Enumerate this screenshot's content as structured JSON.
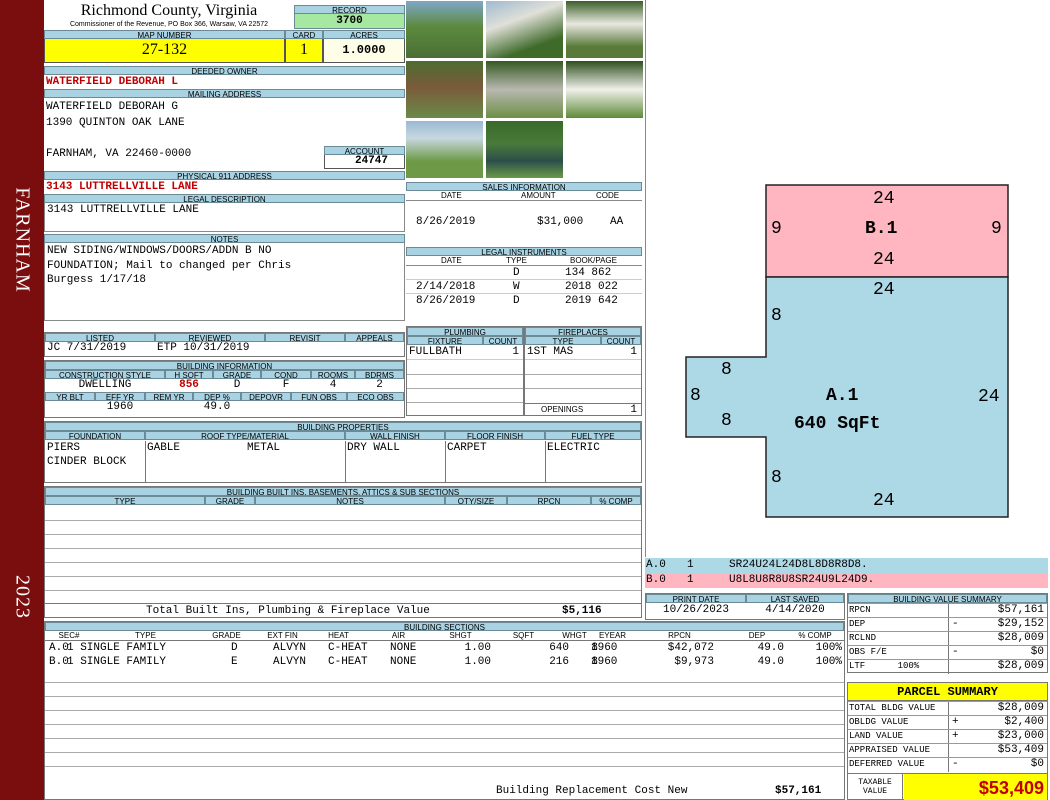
{
  "side": {
    "city": "FARNHAM",
    "year": "2023"
  },
  "header": {
    "county": "Richmond County, Virginia",
    "office": "Commissioner of the Revenue, PO Box 366, Warsaw, VA 22572",
    "record_label": "RECORD",
    "record": "3700",
    "map_label": "MAP NUMBER",
    "map": "27-132",
    "card_label": "CARD",
    "card": "1",
    "acres_label": "ACRES",
    "acres": "1.0000"
  },
  "owner": {
    "deeded_label": "DEEDED OWNER",
    "deeded": "WATERFIELD DEBORAH L",
    "mailing_label": "MAILING ADDRESS",
    "mail_lines": [
      "WATERFIELD DEBORAH G",
      "1390 QUINTON OAK LANE",
      "",
      "FARNHAM, VA 22460-0000"
    ],
    "account_label": "ACCOUNT",
    "account": "24747",
    "physical_label": "PHYSICAL 911 ADDRESS",
    "physical": "3143 LUTTRELLVILLE LANE",
    "legal_label": "LEGAL DESCRIPTION",
    "legal": "3143 LUTTRELLVILLE LANE",
    "notes_label": "NOTES",
    "notes": [
      "NEW SIDING/WINDOWS/DOORS/ADDN B NO",
      "FOUNDATION; Mail to changed per Chris",
      "Burgess 1/17/18"
    ]
  },
  "listing": {
    "h_listed": "LISTED",
    "h_reviewed": "REVIEWED",
    "h_revisit": "REVISIT",
    "h_appeals": "APPEALS",
    "listed": "JC    7/31/2019",
    "reviewed": "ETP  10/31/2019",
    "revisit": "",
    "appeals": ""
  },
  "building_info": {
    "title": "BUILDING INFORMATION",
    "h": [
      "CONSTRUCTION STYLE",
      "H SQFT",
      "GRADE",
      "COND",
      "ROOMS",
      "BDRMS"
    ],
    "v": [
      "DWELLING",
      "856",
      "D",
      "F",
      "4",
      "2"
    ],
    "h2": [
      "YR BLT",
      "EFF YR",
      "REM YR",
      "DEP %",
      "DEPOVR",
      "FUN OBS",
      "ECO OBS"
    ],
    "v2": [
      "",
      "1960",
      "",
      "49.0",
      "",
      "",
      ""
    ]
  },
  "sales": {
    "title": "SALES INFORMATION",
    "h": [
      "DATE",
      "AMOUNT",
      "CODE"
    ],
    "rows": [
      [
        "8/26/2019",
        "$31,000",
        "AA"
      ]
    ]
  },
  "legal_instr": {
    "title": "LEGAL INSTRUMENTS",
    "h": [
      "DATE",
      "TYPE",
      "BOOK/PAGE"
    ],
    "rows": [
      [
        "",
        "D",
        "134 862"
      ],
      [
        "2/14/2018",
        "W",
        "2018 022"
      ],
      [
        "8/26/2019",
        "D",
        "2019 642"
      ]
    ]
  },
  "plumbing": {
    "title": "PLUMBING",
    "h": [
      "FIXTURE",
      "COUNT"
    ],
    "rows": [
      [
        "FULLBATH",
        "1"
      ]
    ]
  },
  "fireplaces": {
    "title": "FIREPLACES",
    "h": [
      "TYPE",
      "COUNT"
    ],
    "rows": [
      [
        "1ST MAS",
        "1"
      ]
    ],
    "openings_label": "OPENINGS",
    "openings": "1"
  },
  "properties": {
    "title": "BUILDING PROPERTIES",
    "h": [
      "FOUNDATION",
      "ROOF TYPE/MATERIAL",
      "WALL FINISH",
      "FLOOR FINISH",
      "FUEL TYPE"
    ],
    "foundation": [
      "PIERS",
      "CINDER BLOCK"
    ],
    "roof_type": "GABLE",
    "roof_mat": "METAL",
    "wall": "DRY WALL",
    "floor": "CARPET",
    "fuel": "ELECTRIC"
  },
  "builtins": {
    "title": "BUILDING BUILT INS, BASEMENTS, ATTICS & SUB SECTIONS",
    "h": [
      "TYPE",
      "GRADE",
      "NOTES",
      "QTY/SIZE",
      "RPCN",
      "% COMP"
    ],
    "total_label": "Total Built Ins, Plumbing & Fireplace Value",
    "total": "$5,116"
  },
  "sections": {
    "title": "BUILDING SECTIONS",
    "h": [
      "SEC#",
      "TYPE",
      "GRADE",
      "EXT FIN",
      "HEAT",
      "AIR",
      "SHGT",
      "SQFT",
      "WHGT",
      "EYEAR",
      "RPCN",
      "DEP",
      "% COMP"
    ],
    "rows": [
      [
        "A.0",
        "1 SINGLE FAMILY",
        "D",
        "ALVYN",
        "C-HEAT",
        "NONE",
        "1.00",
        "640",
        "8",
        "1960",
        "$42,072",
        "49.0",
        "100%"
      ],
      [
        "B.0",
        "1 SINGLE FAMILY",
        "E",
        "ALVYN",
        "C-HEAT",
        "NONE",
        "1.00",
        "216",
        "8",
        "1960",
        "$9,973",
        "49.0",
        "100%"
      ]
    ],
    "brcn_label": "Building Replacement Cost New",
    "brcn": "$57,161"
  },
  "sketch": {
    "b_label": "B.1",
    "a_label": "A.1",
    "a_area": "640 SqFt",
    "b_dims": [
      "24",
      "9",
      "9",
      "24"
    ],
    "a_dims": [
      "24",
      "8",
      "8",
      "8",
      "8",
      "8",
      "24",
      "8",
      "24"
    ],
    "legend": [
      {
        "sec": "A.0",
        "n": "1",
        "path": "SR24U24L24D8L8D8R8D8.",
        "color": "#add8e6"
      },
      {
        "sec": "B.0",
        "n": "1",
        "path": "U8L8U8R8U8SR24U9L24D9.",
        "color": "#ffb6c1"
      }
    ]
  },
  "dates": {
    "print_label": "PRINT DATE",
    "print": "10/26/2023",
    "saved_label": "LAST SAVED",
    "saved": "4/14/2020"
  },
  "bvs": {
    "title": "BUILDING VALUE SUMMARY",
    "rows": [
      {
        "k": "RPCN",
        "s": "",
        "v": "$57,161"
      },
      {
        "k": "DEP",
        "s": "-",
        "v": "$29,152"
      },
      {
        "k": "RCLND",
        "s": "",
        "v": "$28,009"
      },
      {
        "k": "OBS F/E",
        "s": "-",
        "v": "$0"
      },
      {
        "k": "LTF      100%",
        "s": "",
        "v": "$28,009"
      }
    ]
  },
  "parcel": {
    "title": "PARCEL SUMMARY",
    "rows": [
      {
        "k": "TOTAL BLDG VALUE",
        "s": "",
        "v": "$28,009"
      },
      {
        "k": "OBLDG VALUE",
        "s": "+",
        "v": "$2,400"
      },
      {
        "k": "LAND VALUE",
        "s": "+",
        "v": "$23,000"
      },
      {
        "k": "APPRAISED VALUE",
        "s": "",
        "v": "$53,409"
      },
      {
        "k": "DEFERRED VALUE",
        "s": "-",
        "v": "$0"
      }
    ],
    "taxable_label": "TAXABLE VALUE",
    "taxable": "$53,409"
  }
}
